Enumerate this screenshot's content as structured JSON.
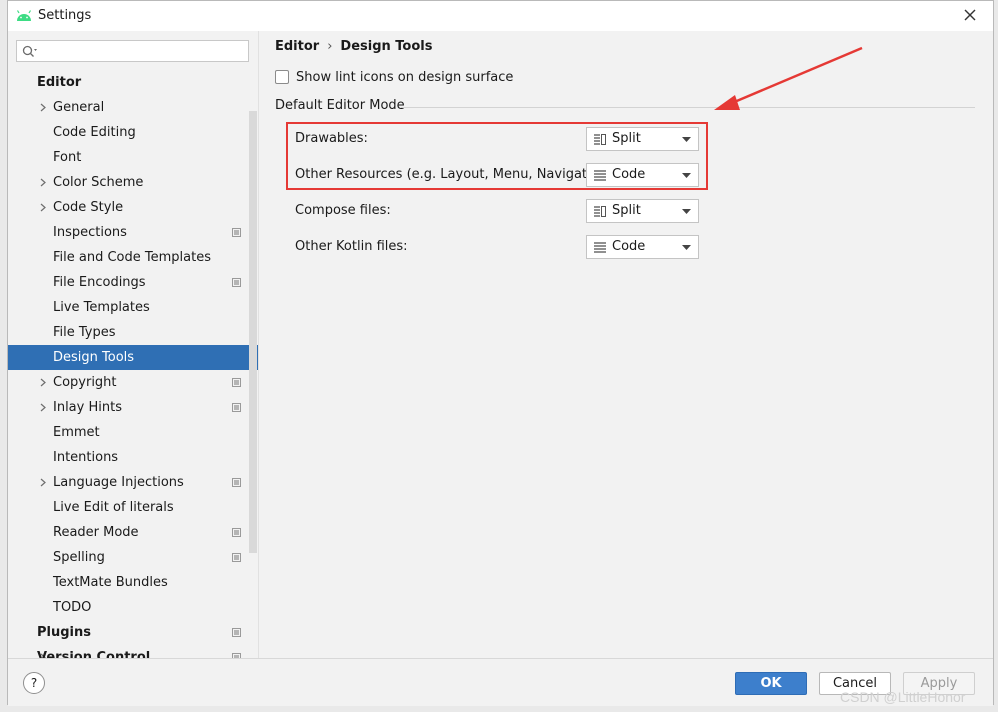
{
  "window": {
    "title": "Settings"
  },
  "search": {
    "placeholder": "",
    "value": ""
  },
  "sidebar": {
    "items": [
      {
        "label": "Editor",
        "kind": "section"
      },
      {
        "label": "General",
        "expandable": true
      },
      {
        "label": "Code Editing"
      },
      {
        "label": "Font"
      },
      {
        "label": "Color Scheme",
        "expandable": true
      },
      {
        "label": "Code Style",
        "expandable": true
      },
      {
        "label": "Inspections",
        "project": true
      },
      {
        "label": "File and Code Templates"
      },
      {
        "label": "File Encodings",
        "project": true
      },
      {
        "label": "Live Templates"
      },
      {
        "label": "File Types"
      },
      {
        "label": "Design Tools",
        "selected": true
      },
      {
        "label": "Copyright",
        "expandable": true,
        "project": true
      },
      {
        "label": "Inlay Hints",
        "expandable": true,
        "project": true
      },
      {
        "label": "Emmet"
      },
      {
        "label": "Intentions"
      },
      {
        "label": "Language Injections",
        "expandable": true,
        "project": true
      },
      {
        "label": "Live Edit of literals"
      },
      {
        "label": "Reader Mode",
        "project": true
      },
      {
        "label": "Spelling",
        "project": true
      },
      {
        "label": "TextMate Bundles"
      },
      {
        "label": "TODO"
      },
      {
        "label": "Plugins",
        "kind": "section",
        "project": true
      },
      {
        "label": "Version Control",
        "kind": "section",
        "expandable": true,
        "project": true
      }
    ]
  },
  "breadcrumb": {
    "parent": "Editor",
    "separator": "›",
    "current": "Design Tools"
  },
  "lint_checkbox": {
    "label": "Show lint icons on design surface",
    "checked": false
  },
  "group": {
    "title": "Default Editor Mode"
  },
  "modes": [
    {
      "label": "Drawables:",
      "value": "Split",
      "icon": "split-icon"
    },
    {
      "label": "Other Resources (e.g. Layout, Menu, Navigation):",
      "value": "Code",
      "icon": "code-icon"
    },
    {
      "label": "Compose files:",
      "value": "Split",
      "icon": "split-icon"
    },
    {
      "label": "Other Kotlin files:",
      "value": "Code",
      "icon": "code-icon"
    }
  ],
  "footer": {
    "help": "?",
    "ok": "OK",
    "cancel": "Cancel",
    "apply": "Apply"
  },
  "watermark": "CSDN @LittleHonor",
  "colors": {
    "selection": "#2f6fb4",
    "ok": "#3d7fcc",
    "highlight": "#e53935",
    "android": "#3ddc84"
  }
}
